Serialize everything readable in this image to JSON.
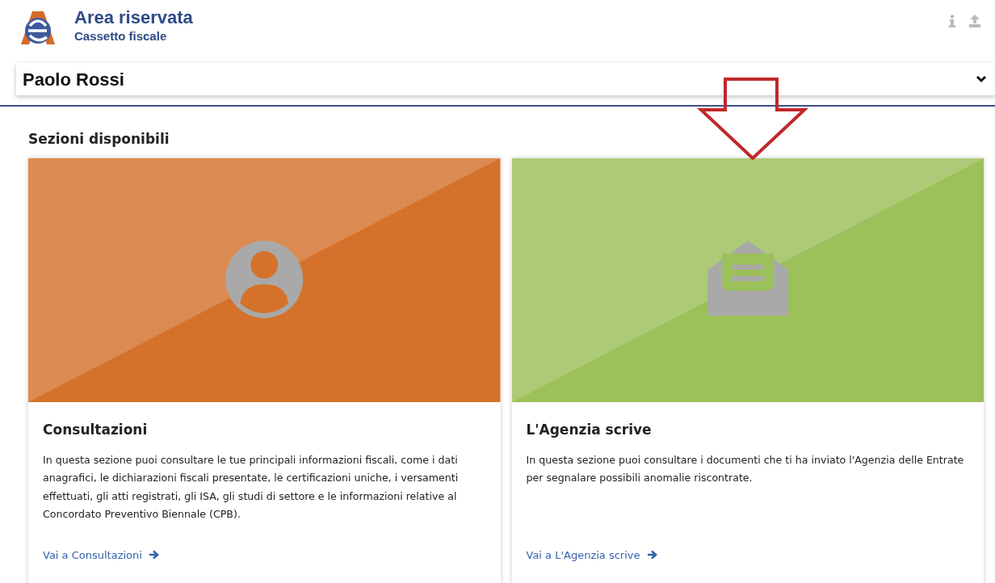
{
  "header": {
    "title": "Area riservata",
    "subtitle": "Cassetto fiscale"
  },
  "user": {
    "name": "Paolo Rossi",
    "expanded": false
  },
  "section_title": "Sezioni disponibili",
  "cards": [
    {
      "kind": "person",
      "color": "#d4722c",
      "title": "Consultazioni",
      "text": "In questa sezione puoi consultare le tue principali informazioni fiscali, come i dati anagrafici, le dichiarazioni fiscali presentate, le certificazioni uniche, i versamenti effettuati, gli atti registrati, gli ISA, gli studi di settore e le informazioni relative al Concordato Preventivo Biennale (CPB).",
      "link": "Vai a Consultazioni"
    },
    {
      "kind": "mail",
      "color": "#9cc05a",
      "title": "L'Agenzia scrive",
      "text": "In questa sezione puoi consultare i documenti che ti ha inviato l'Agenzia delle Entrate per segnalare possibili anomalie riscontrate.",
      "link": "Vai a L'Agenzia scrive"
    }
  ]
}
